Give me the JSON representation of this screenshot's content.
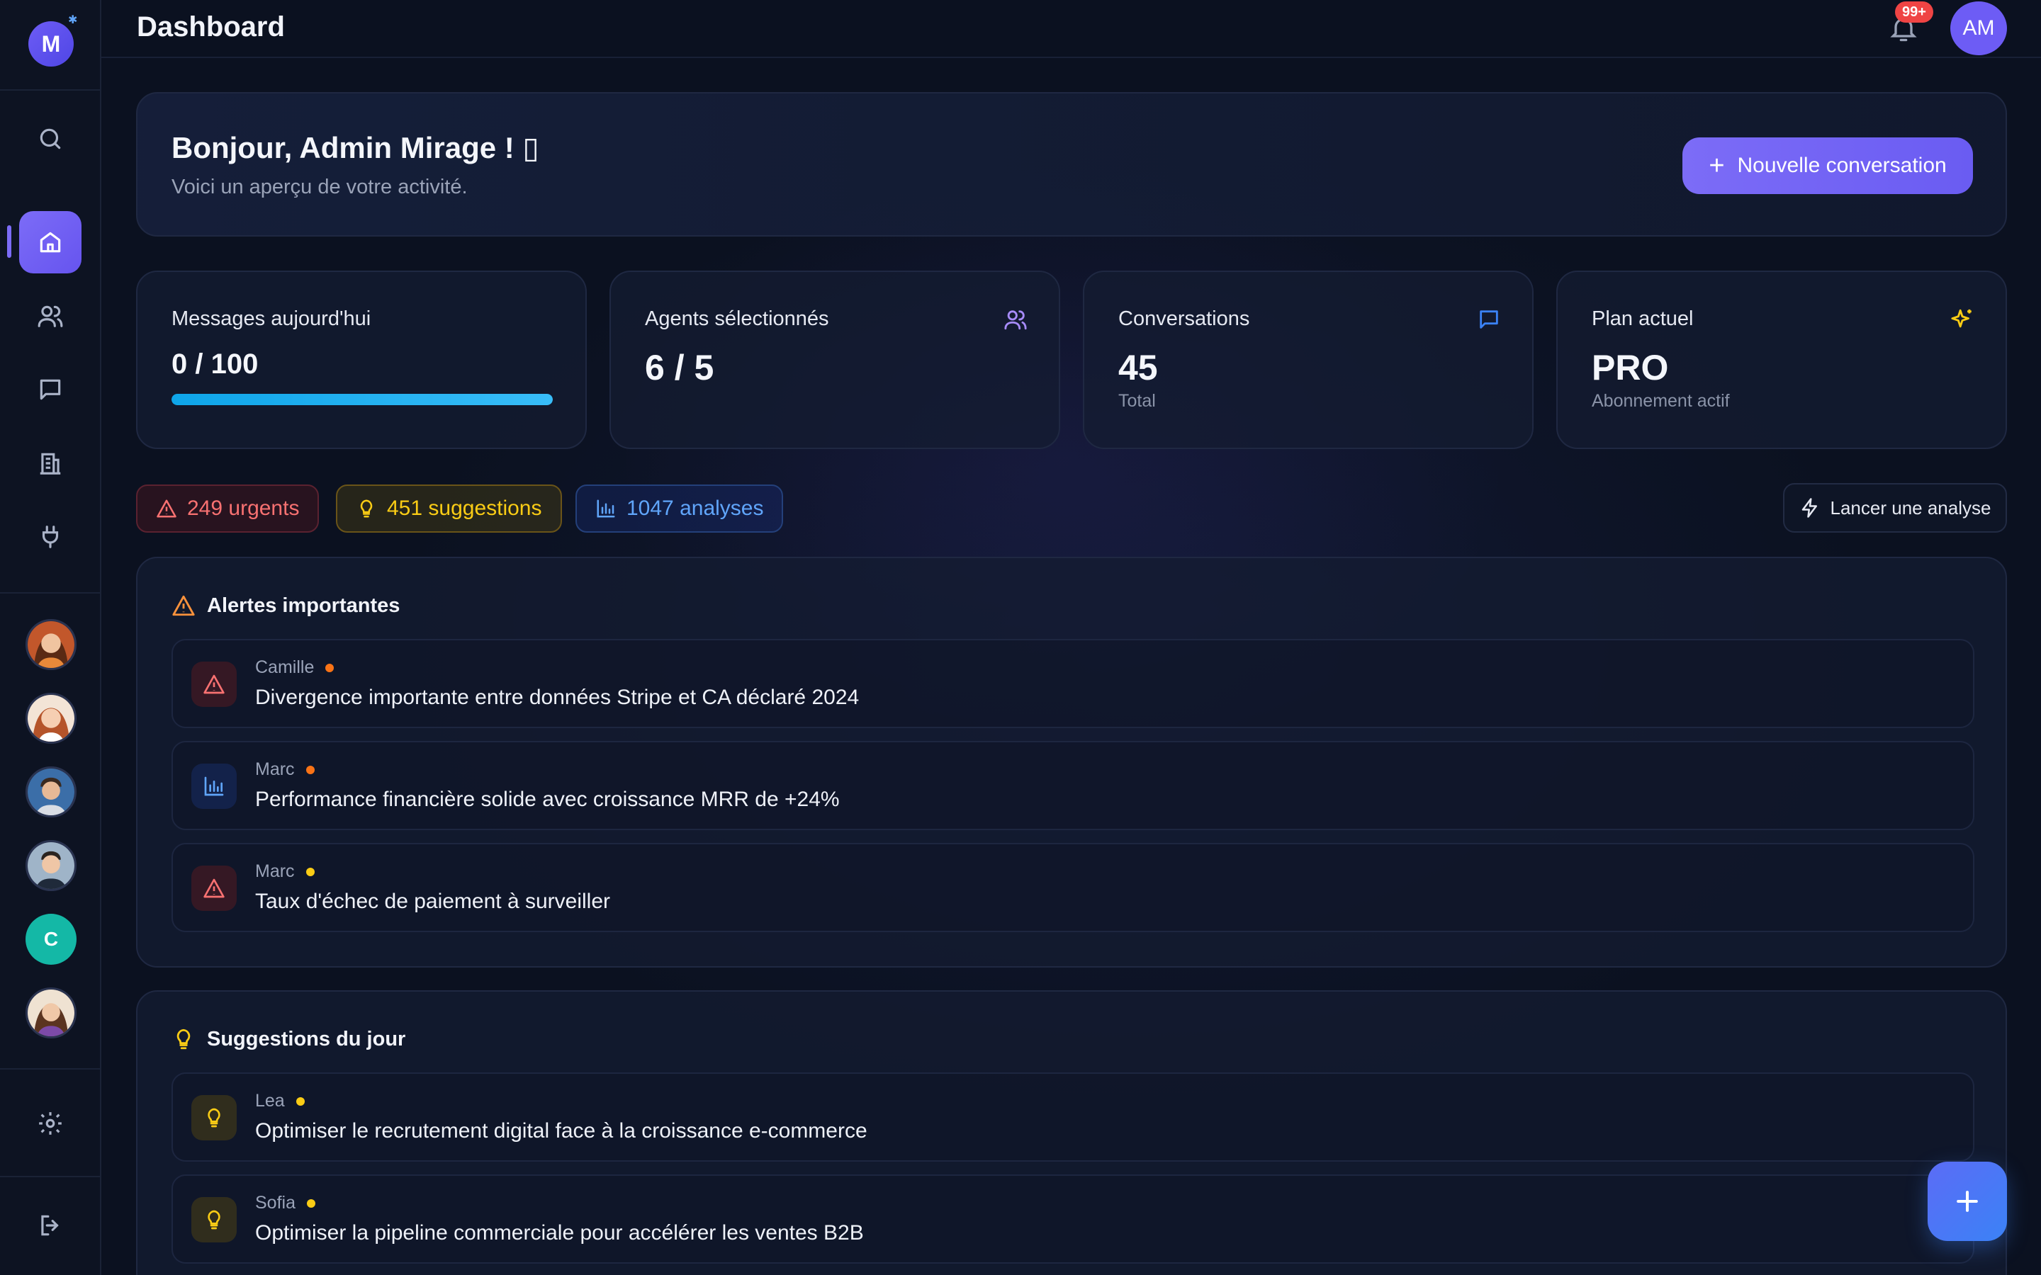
{
  "app": {
    "logo_letter": "M",
    "page_title": "Dashboard"
  },
  "topbar": {
    "notification_count": "99+",
    "user_initials": "AM"
  },
  "sidebar": {
    "nav": [
      {
        "name": "search",
        "icon": "search-icon"
      },
      {
        "name": "home",
        "icon": "home-icon",
        "active": true
      },
      {
        "name": "users",
        "icon": "users-icon"
      },
      {
        "name": "messages",
        "icon": "message-icon"
      },
      {
        "name": "company",
        "icon": "building-icon"
      },
      {
        "name": "integrations",
        "icon": "plug-icon"
      }
    ],
    "avatars": [
      {
        "letter": ""
      },
      {
        "letter": ""
      },
      {
        "letter": ""
      },
      {
        "letter": ""
      },
      {
        "letter": "C"
      },
      {
        "letter": ""
      }
    ],
    "settings_icon": "gear-icon",
    "logout_icon": "logout-icon"
  },
  "welcome": {
    "greeting": "Bonjour, Admin Mirage ! ▯",
    "subtitle": "Voici un aperçu de votre activité.",
    "new_conversation_label": "Nouvelle conversation"
  },
  "stats": {
    "messages": {
      "label": "Messages aujourd'hui",
      "value": "0 / 100",
      "progress": 1.0
    },
    "agents": {
      "label": "Agents sélectionnés",
      "value": "6 / 5"
    },
    "conversations": {
      "label": "Conversations",
      "value": "45",
      "sub": "Total"
    },
    "plan": {
      "label": "Plan actuel",
      "value": "PRO",
      "sub": "Abonnement actif"
    }
  },
  "pills": {
    "urgent": "249 urgents",
    "suggestions": "451 suggestions",
    "analyses": "1047 analyses",
    "launch": "Lancer une analyse"
  },
  "alerts": {
    "title": "Alertes importantes",
    "items": [
      {
        "author": "Camille",
        "text": "Divergence importante entre données Stripe et CA déclaré 2024"
      },
      {
        "author": "Marc",
        "text": "Performance financière solide avec croissance MRR de +24%"
      },
      {
        "author": "Marc",
        "text": "Taux d'échec de paiement à surveiller"
      }
    ]
  },
  "suggestions": {
    "title": "Suggestions du jour",
    "items": [
      {
        "author": "Lea",
        "text": "Optimiser le recrutement digital face à la croissance e-commerce"
      },
      {
        "author": "Sofia",
        "text": "Optimiser la pipeline commerciale pour accélérer les ventes B2B"
      }
    ]
  },
  "colors": {
    "accent": "#7c6cf7",
    "urgent": "#f87171",
    "suggestion": "#facc15",
    "analysis": "#60a5fa"
  }
}
